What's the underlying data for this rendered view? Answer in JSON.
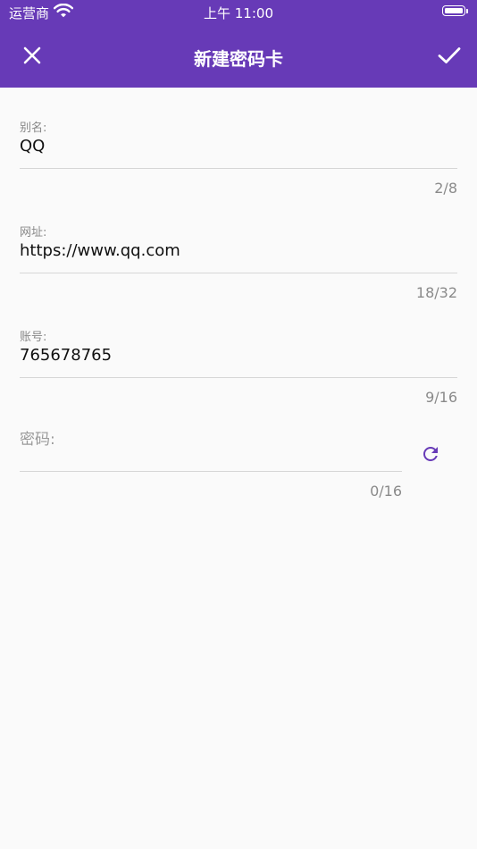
{
  "status_bar": {
    "carrier": "运营商",
    "time": "上午 11:00"
  },
  "app_bar": {
    "title": "新建密码卡",
    "close_icon": "close-icon",
    "confirm_icon": "check-icon"
  },
  "colors": {
    "primary": "#673ab7",
    "background": "#fafafa",
    "divider": "#d6d6d6",
    "hint": "#888888"
  },
  "form": {
    "alias": {
      "label": "别名:",
      "value": "QQ",
      "counter": "2/8"
    },
    "url": {
      "label": "网址:",
      "value": "https://www.qq.com",
      "counter": "18/32"
    },
    "account": {
      "label": "账号:",
      "value": "765678765",
      "counter": "9/16"
    },
    "password": {
      "placeholder": "密码:",
      "value": "",
      "counter": "0/16",
      "refresh_icon": "refresh-icon"
    }
  }
}
